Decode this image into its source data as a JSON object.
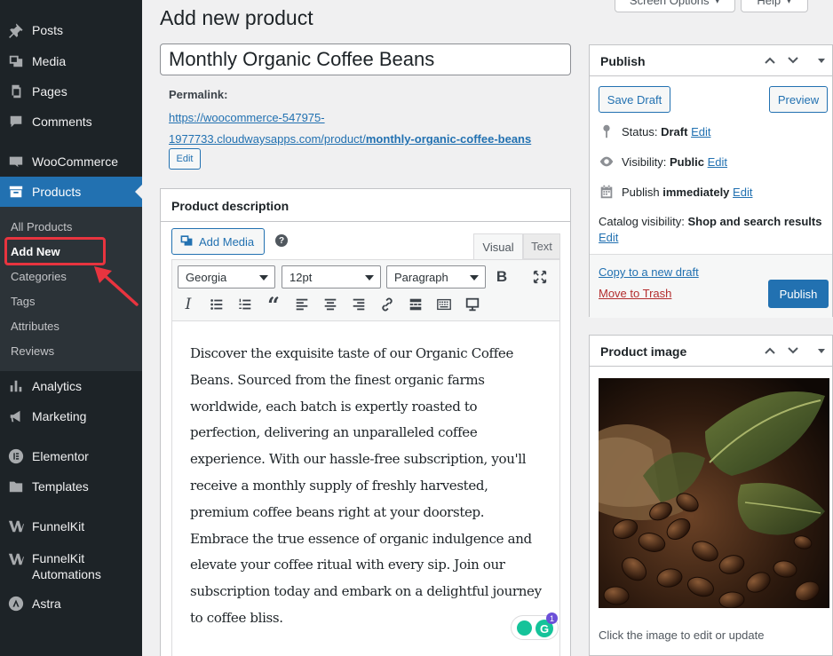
{
  "sidebar": {
    "items": [
      {
        "label": "Posts",
        "icon": "pin-icon"
      },
      {
        "label": "Media",
        "icon": "media-icon"
      },
      {
        "label": "Pages",
        "icon": "pages-icon"
      },
      {
        "label": "Comments",
        "icon": "comments-icon"
      },
      {
        "label": "WooCommerce",
        "icon": "woocommerce-icon"
      },
      {
        "label": "Products",
        "icon": "archive-icon"
      },
      {
        "label": "Analytics",
        "icon": "bar-chart-icon"
      },
      {
        "label": "Marketing",
        "icon": "megaphone-icon"
      },
      {
        "label": "Elementor",
        "icon": "elementor-icon"
      },
      {
        "label": "Templates",
        "icon": "folder-icon"
      },
      {
        "label": "FunnelKit",
        "icon": "funnelkit-icon"
      },
      {
        "label": "FunnelKit Automations",
        "icon": "funnelkit-icon"
      },
      {
        "label": "Astra",
        "icon": "astra-icon"
      }
    ],
    "submenu": [
      "All Products",
      "Add New",
      "Categories",
      "Tags",
      "Attributes",
      "Reviews"
    ],
    "highlight_color": "#e8343f"
  },
  "header": {
    "title": "Add new product",
    "screen_options": "Screen Options",
    "help": "Help"
  },
  "product": {
    "title_value": "Monthly Organic Coffee Beans",
    "permalink_label": "Permalink:",
    "permalink_base_1": "https://woocommerce-547975-",
    "permalink_base_2": "1977733.cloudwaysapps.com/product/",
    "permalink_slug": "monthly-organic-coffee-beans",
    "permalink_edit": "Edit"
  },
  "description": {
    "header": "Product description",
    "add_media": "Add Media",
    "help_glyph": "?",
    "tab_visual": "Visual",
    "tab_text": "Text",
    "font_family": "Georgia",
    "font_size": "12pt",
    "format": "Paragraph",
    "content": "Discover the exquisite taste of our Organic Coffee Beans. Sourced from the finest organic farms worldwide, each batch is expertly roasted to perfection, delivering an unparalleled coffee experience. With our hassle-free subscription, you'll receive a monthly supply of freshly harvested, premium coffee beans right at your doorstep. Embrace the true essence of organic indulgence and elevate your coffee ritual with every sip. Join our subscription today and embark on a delightful journey to coffee bliss.",
    "grammarly_count": "1"
  },
  "publish": {
    "title": "Publish",
    "save_draft": "Save Draft",
    "preview": "Preview",
    "status_label": "Status:",
    "status_value": "Draft",
    "visibility_label": "Visibility:",
    "visibility_value": "Public",
    "publish_label": "Publish",
    "publish_value": "immediately",
    "catalog_label": "Catalog visibility:",
    "catalog_value": "Shop and search results",
    "edit": "Edit",
    "copy_draft": "Copy to a new draft",
    "move_trash": "Move to Trash",
    "publish_button": "Publish"
  },
  "product_image": {
    "title": "Product image",
    "caption": "Click the image to edit or update"
  },
  "colors": {
    "accent": "#2271b1",
    "sidebar_bg": "#1d2327",
    "trash": "#b32d2e"
  }
}
